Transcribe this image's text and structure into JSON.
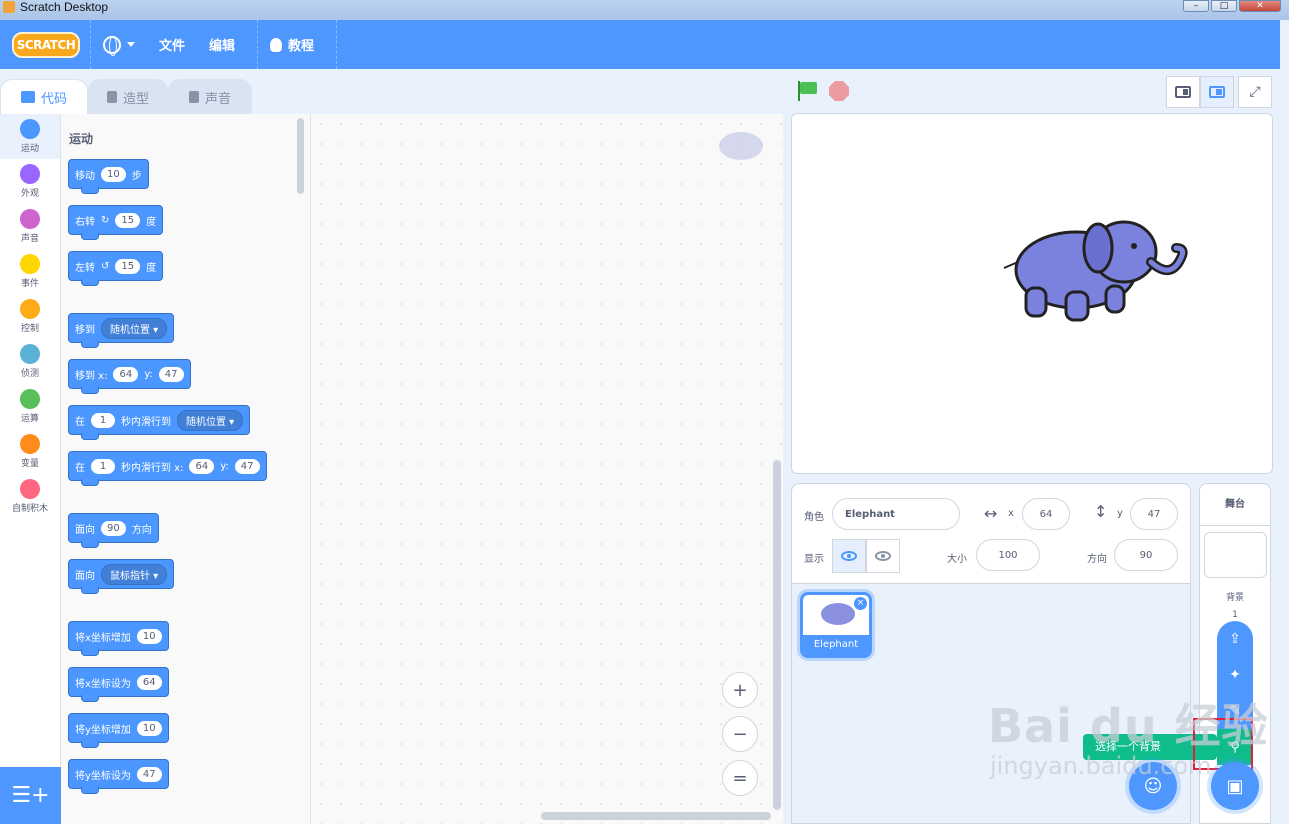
{
  "window": {
    "title": "Scratch Desktop",
    "controls": [
      "–",
      "□",
      "✕"
    ]
  },
  "menubar": {
    "logo": "SCRATCH",
    "file": "文件",
    "edit": "编辑",
    "tutorials": "教程"
  },
  "tabs": [
    {
      "label": "代码",
      "active": true
    },
    {
      "label": "造型",
      "active": false
    },
    {
      "label": "声音",
      "active": false
    }
  ],
  "categories": [
    {
      "label": "运动",
      "color": "#4c97ff",
      "active": true
    },
    {
      "label": "外观",
      "color": "#9966ff"
    },
    {
      "label": "声音",
      "color": "#cf63cf"
    },
    {
      "label": "事件",
      "color": "#ffd500"
    },
    {
      "label": "控制",
      "color": "#ffab19"
    },
    {
      "label": "侦测",
      "color": "#5cb1d6"
    },
    {
      "label": "运算",
      "color": "#59c059"
    },
    {
      "label": "变量",
      "color": "#ff8c1a"
    },
    {
      "label": "自制积木",
      "color": "#ff6680"
    }
  ],
  "palette": {
    "section_title": "运动",
    "blocks": {
      "move": {
        "pre": "移动",
        "val": "10",
        "post": "步"
      },
      "turn_right": {
        "pre": "右转",
        "icon": "↻",
        "val": "15",
        "post": "度"
      },
      "turn_left": {
        "pre": "左转",
        "icon": "↺",
        "val": "15",
        "post": "度"
      },
      "goto": {
        "pre": "移到",
        "dd": "随机位置"
      },
      "goto_xy": {
        "pre": "移到 x:",
        "x": "64",
        "ymid": "y:",
        "y": "47"
      },
      "glide": {
        "pre": "在",
        "val": "1",
        "mid": "秒内滑行到",
        "dd": "随机位置"
      },
      "glide_xy": {
        "pre": "在",
        "val": "1",
        "mid": "秒内滑行到 x:",
        "x": "64",
        "ymid": "y:",
        "y": "47"
      },
      "point_dir": {
        "pre": "面向",
        "val": "90",
        "post": "方向"
      },
      "point_towards": {
        "pre": "面向",
        "dd": "鼠标指针"
      },
      "change_x": {
        "pre": "将x坐标增加",
        "val": "10"
      },
      "set_x": {
        "pre": "将x坐标设为",
        "val": "64"
      },
      "change_y": {
        "pre": "将y坐标增加",
        "val": "10"
      },
      "set_y": {
        "pre": "将y坐标设为",
        "val": "47"
      }
    }
  },
  "zoom": {
    "in": "+",
    "out": "−",
    "reset": "="
  },
  "sprite_info": {
    "sprite_label": "角色",
    "sprite_name": "Elephant",
    "x_label": "x",
    "x": "64",
    "y_label": "y",
    "y": "47",
    "show_label": "显示",
    "size_label": "大小",
    "size": "100",
    "direction_label": "方向",
    "direction": "90"
  },
  "sprites": [
    {
      "name": "Elephant"
    }
  ],
  "stage_target": {
    "title": "舞台",
    "backdrops_label": "背景",
    "backdrop_count": "1"
  },
  "tooltip": {
    "text": "选择一个背景"
  },
  "watermark": {
    "main": "Bai du 经验",
    "sub": "jingyan.baidu.com"
  }
}
